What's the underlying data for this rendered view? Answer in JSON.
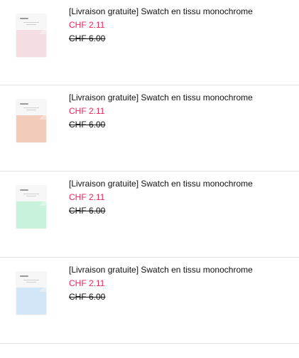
{
  "products": [
    {
      "title": "[Livraison gratuite] Swatch en tissu monochrome",
      "sale_price": "CHF 2.11",
      "original_price": "CHF 6.00",
      "swatch_color": "#f5dde4"
    },
    {
      "title": "[Livraison gratuite] Swatch en tissu monochrome",
      "sale_price": "CHF 2.11",
      "original_price": "CHF 6.00",
      "swatch_color": "#f3cbbb"
    },
    {
      "title": "[Livraison gratuite] Swatch en tissu monochrome",
      "sale_price": "CHF 2.11",
      "original_price": "CHF 6.00",
      "swatch_color": "#c9f2dc"
    },
    {
      "title": "[Livraison gratuite] Swatch en tissu monochrome",
      "sale_price": "CHF 2.11",
      "original_price": "CHF 6.00",
      "swatch_color": "#d3e6f7"
    }
  ],
  "colors": {
    "sale_price": "#e8265a",
    "divider": "#e2e2e2"
  }
}
